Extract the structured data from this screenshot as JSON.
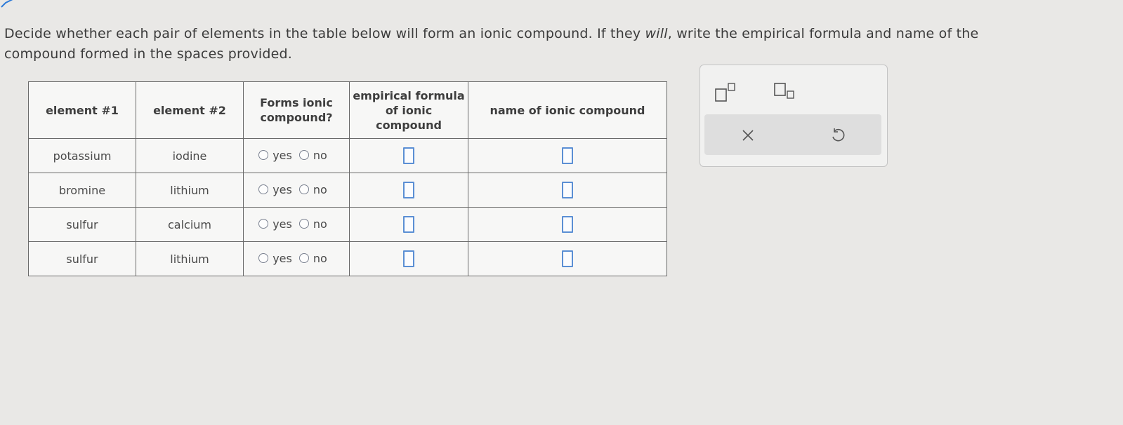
{
  "instructions": {
    "part1": "Decide whether each pair of elements in the table below will form an ionic compound. If they ",
    "emph": "will",
    "part2": ", write the empirical formula and name of the compound formed in the spaces provided."
  },
  "table": {
    "headers": {
      "element1": "element #1",
      "element2": "element #2",
      "forms_ionic": "Forms ionic compound?",
      "empirical_formula": "empirical formula of ionic compound",
      "name": "name of ionic compound"
    },
    "rows": [
      {
        "element1": "potassium",
        "element2": "iodine"
      },
      {
        "element1": "bromine",
        "element2": "lithium"
      },
      {
        "element1": "sulfur",
        "element2": "calcium"
      },
      {
        "element1": "sulfur",
        "element2": "lithium"
      }
    ],
    "options": {
      "yes": "yes",
      "no": "no"
    }
  },
  "toolbox": {
    "tools": [
      "superscript-icon",
      "subscript-icon",
      "clear-icon",
      "undo-icon"
    ]
  },
  "colors": {
    "answer_box_border": "#5b8fd4",
    "background": "#e9e8e6"
  }
}
